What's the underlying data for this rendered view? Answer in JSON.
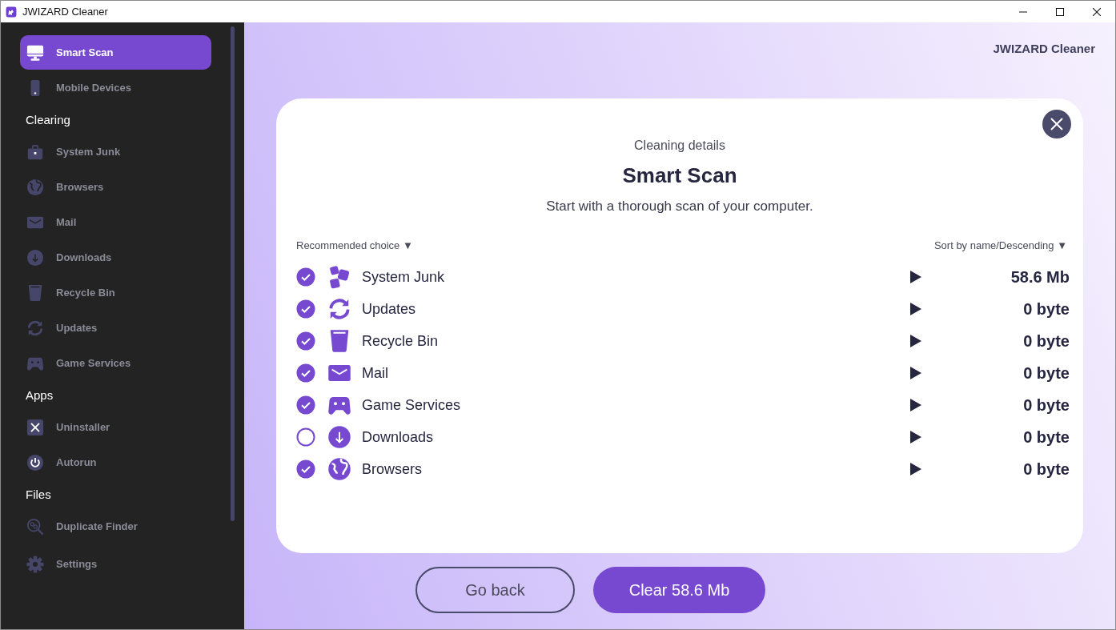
{
  "window": {
    "title": "JWIZARD Cleaner"
  },
  "sidebar": {
    "groups": [
      {
        "items": [
          {
            "label": "Smart Scan",
            "selected": true
          },
          {
            "label": "Mobile Devices",
            "selected": false
          }
        ]
      },
      {
        "heading": "Clearing",
        "items": [
          {
            "label": "System Junk",
            "selected": false
          },
          {
            "label": "Browsers",
            "selected": false
          },
          {
            "label": "Mail",
            "selected": false
          },
          {
            "label": "Downloads",
            "selected": false
          },
          {
            "label": "Recycle Bin",
            "selected": false
          },
          {
            "label": "Updates",
            "selected": false
          },
          {
            "label": "Game Services",
            "selected": false
          }
        ]
      },
      {
        "heading": "Apps",
        "items": [
          {
            "label": "Uninstaller",
            "selected": false
          },
          {
            "label": "Autorun",
            "selected": false
          }
        ]
      },
      {
        "heading": "Files",
        "items": [
          {
            "label": "Duplicate Finder",
            "selected": false
          }
        ]
      }
    ],
    "footer_item": {
      "label": "Settings",
      "selected": false
    }
  },
  "brand": "JWIZARD Cleaner",
  "dialog": {
    "subtitle": "Cleaning details",
    "title": "Smart Scan",
    "description": "Start with a thorough scan of your computer.",
    "filter": "Recommended choice ▼",
    "sort": "Sort by name/Descending ▼",
    "rows": [
      {
        "label": "System Junk",
        "size": "58.6 Mb",
        "checked": true
      },
      {
        "label": "Updates",
        "size": "0 byte",
        "checked": true
      },
      {
        "label": "Recycle Bin",
        "size": "0 byte",
        "checked": true
      },
      {
        "label": "Mail",
        "size": "0 byte",
        "checked": true
      },
      {
        "label": "Game Services",
        "size": "0 byte",
        "checked": true
      },
      {
        "label": "Downloads",
        "size": "0 byte",
        "checked": false
      },
      {
        "label": "Browsers",
        "size": "0 byte",
        "checked": true
      }
    ]
  },
  "buttons": {
    "back": "Go back",
    "clear": "Clear 58.6 Mb"
  }
}
